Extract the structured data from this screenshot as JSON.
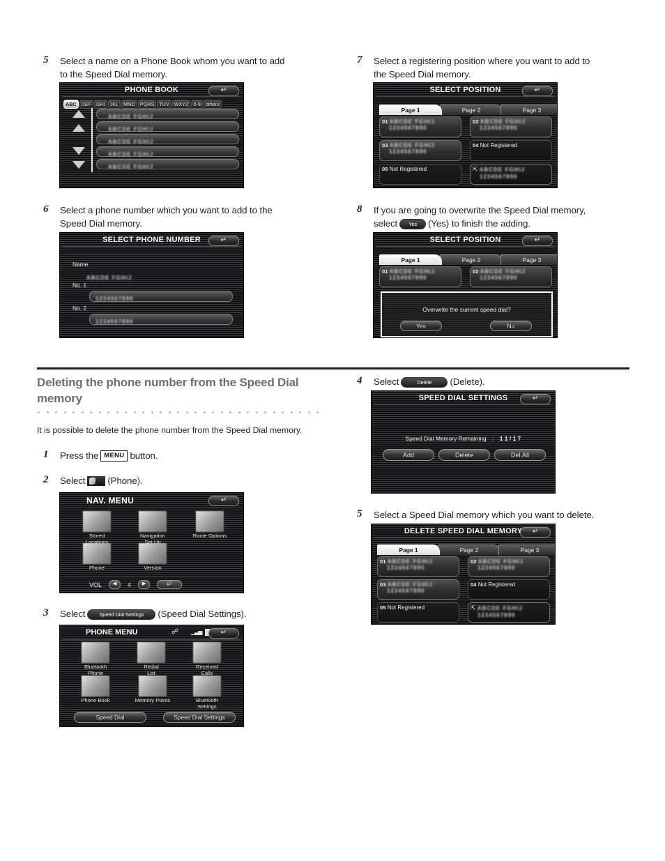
{
  "colors": {
    "text": "#231f20",
    "heading_gray": "#6d6e70",
    "screen_bg": "#111113",
    "rule": "#231f20"
  },
  "steps_top": [
    {
      "num": "5",
      "lines": [
        "Select a name on a Phone Book whom you want to add",
        "to the Speed Dial memory."
      ]
    },
    {
      "num": "6",
      "lines": [
        "Select a phone number which you want to add to the",
        "Speed Dial memory."
      ]
    },
    {
      "num": "7",
      "lines": [
        "Select a registering position where you want to add to",
        "the Speed Dial memory."
      ]
    },
    {
      "num": "8",
      "lines_pre": "If you are going to overwrite the Speed Dial memory,",
      "select_word": "select",
      "inline_button": "Yes",
      "lines_post": "(Yes) to finish the adding."
    }
  ],
  "phone_book_screen": {
    "title": "PHONE BOOK",
    "back_icon": "back-arrow-icon",
    "alphabet_tabs": [
      "ABC",
      "DEF",
      "GHI",
      "JKL",
      "MNO",
      "PQRS",
      "TUV",
      "WXYZ",
      "0-9",
      "others"
    ],
    "selected_tab": "ABC",
    "rows": [
      "ABCDE FGHIJ",
      "ABCDE FGHIJ",
      "ABCDE FGHIJ",
      "ABCDE FGHIJ",
      "ABCDE FGHIJ"
    ],
    "scroll_icons": [
      "double-up-arrow-icon",
      "up-arrow-icon",
      "down-arrow-icon",
      "double-down-arrow-icon"
    ]
  },
  "select_phone_number_screen": {
    "title": "SELECT PHONE NUMBER",
    "back_icon": "back-arrow-icon",
    "name_label": "Name",
    "name_value": "ABCDE FGHIJ",
    "entries": [
      {
        "label": "No. 1",
        "value": "1234567890"
      },
      {
        "label": "No. 2",
        "value": "1234567890"
      }
    ]
  },
  "select_position_screen": {
    "title": "SELECT POSITION",
    "back_icon": "back-arrow-icon",
    "page_tabs": [
      "Page 1",
      "Page 2",
      "Page 3"
    ],
    "selected_page": "Page 1",
    "cells": [
      {
        "index": "01",
        "line1": "ABCDE FGHIJ",
        "line2": "1234567890",
        "registered": true
      },
      {
        "index": "02",
        "line1": "ABCDE FGHIJ",
        "line2": "1234567890",
        "registered": true
      },
      {
        "index": "03",
        "line1": "ABCDE FGHIJ",
        "line2": "1234567890",
        "registered": true
      },
      {
        "index": "04",
        "line1": "Not Registered",
        "line2": "",
        "registered": false
      },
      {
        "index": "05",
        "line1": "Not Registered",
        "line2": "",
        "registered": false
      },
      {
        "index": "phone-in-icon",
        "line1": "ABCDE FGHIJ",
        "line2": "1234567890",
        "registered": true
      }
    ]
  },
  "overwrite_screen": {
    "title": "SELECT POSITION",
    "back_icon": "back-arrow-icon",
    "page_tabs": [
      "Page 1",
      "Page 2",
      "Page 3"
    ],
    "selected_page": "Page 1",
    "cells": [
      {
        "index": "01",
        "line1": "ABCDE FGHIJ",
        "line2": "1234567890"
      },
      {
        "index": "02",
        "line1": "ABCDE FGHIJ",
        "line2": "1234567890"
      }
    ],
    "dialog": {
      "message": "Overwrite the current speed dial?",
      "yes_label": "Yes",
      "no_label": "No"
    }
  },
  "section": {
    "heading_lines": [
      "Deleting the phone number from the Speed Dial",
      "memory"
    ],
    "intro": "It is possible to delete the phone number from the Speed Dial memory.",
    "dot_count": 33
  },
  "steps_bottom_left": [
    {
      "num": "1",
      "pre": "Press the",
      "key": "MENU",
      "post": "button."
    },
    {
      "num": "2",
      "pre": "Select",
      "icon": "phone-icon",
      "post": "(Phone)."
    },
    {
      "num": "3",
      "pre": "Select",
      "button": "Speed Dial Settings",
      "post": "(Speed Dial Settings)."
    }
  ],
  "steps_bottom_right": [
    {
      "num": "4",
      "pre": "Select",
      "button": "Delete",
      "post": "(Delete)."
    },
    {
      "num": "5",
      "text": "Select a Speed Dial memory which you want to delete."
    }
  ],
  "nav_menu_screen": {
    "title": "NAV. MENU",
    "back_icon": "back-arrow-icon",
    "tiles": [
      {
        "icon": "pin-icon",
        "caption": [
          "Stored",
          "Locations"
        ]
      },
      {
        "icon": "map-setup-icon",
        "caption": [
          "Navigation",
          "Set Up"
        ]
      },
      {
        "icon": "pencil-route-icon",
        "caption": [
          "Route Options"
        ]
      },
      {
        "icon": "phone-handset-icon",
        "caption": [
          "Phone"
        ]
      },
      {
        "icon": "disc-icon",
        "caption": [
          "Version"
        ]
      }
    ],
    "volume": {
      "label": "VOL",
      "down_icon": "left-triangle-icon",
      "value": "4",
      "up_icon": "right-triangle-icon",
      "mute_icon": "speaker-icon"
    }
  },
  "phone_menu_screen": {
    "title": "PHONE MENU",
    "status_icons": [
      "bluetooth-icon",
      "signal-bars-icon",
      "battery-icon"
    ],
    "back_icon": "back-arrow-icon",
    "tiles": [
      {
        "icon": "bluetooth-phone-icon",
        "caption": [
          "Bluetooth",
          "Phone"
        ]
      },
      {
        "icon": "redial-icon",
        "caption": [
          "Redial",
          "List"
        ]
      },
      {
        "icon": "received-calls-icon",
        "caption": [
          "Received",
          "Calls"
        ]
      },
      {
        "icon": "phone-book-icon",
        "caption": [
          "Phone Book"
        ]
      },
      {
        "icon": "memory-points-icon",
        "caption": [
          "Memory Points"
        ]
      },
      {
        "icon": "bluetooth-settings-icon",
        "caption": [
          "Bluetooth",
          "Settings"
        ]
      }
    ],
    "buttons": [
      "Speed Dial",
      "Speed Dial Settings"
    ]
  },
  "speed_dial_settings_screen": {
    "title": "SPEED DIAL SETTINGS",
    "back_icon": "back-arrow-icon",
    "memory_label": "Speed Dial Memory Remaining",
    "memory_separator": ":",
    "memory_value": "1 1 / 1 7",
    "buttons": [
      "Add",
      "Delete",
      "Del.All"
    ]
  },
  "delete_speed_dial_screen": {
    "title": "DELETE SPEED DIAL MEMORY",
    "back_icon": "back-arrow-icon",
    "page_tabs": [
      "Page 1",
      "Page 2",
      "Page 3"
    ],
    "selected_page": "Page 1",
    "cells": [
      {
        "index": "01",
        "line1": "ABCDE FGHIJ",
        "line2": "1234567890",
        "registered": true
      },
      {
        "index": "02",
        "line1": "ABCDE FGHIJ",
        "line2": "1234567890",
        "registered": true
      },
      {
        "index": "03",
        "line1": "ABCDE FGHIJ",
        "line2": "1234567890",
        "registered": true
      },
      {
        "index": "04",
        "line1": "Not Registered",
        "line2": "",
        "registered": false
      },
      {
        "index": "05",
        "line1": "Not Registered",
        "line2": "",
        "registered": false
      },
      {
        "index": "phone-in-icon",
        "line1": "ABCDE FGHIJ",
        "line2": "1234567890",
        "registered": true
      }
    ]
  }
}
